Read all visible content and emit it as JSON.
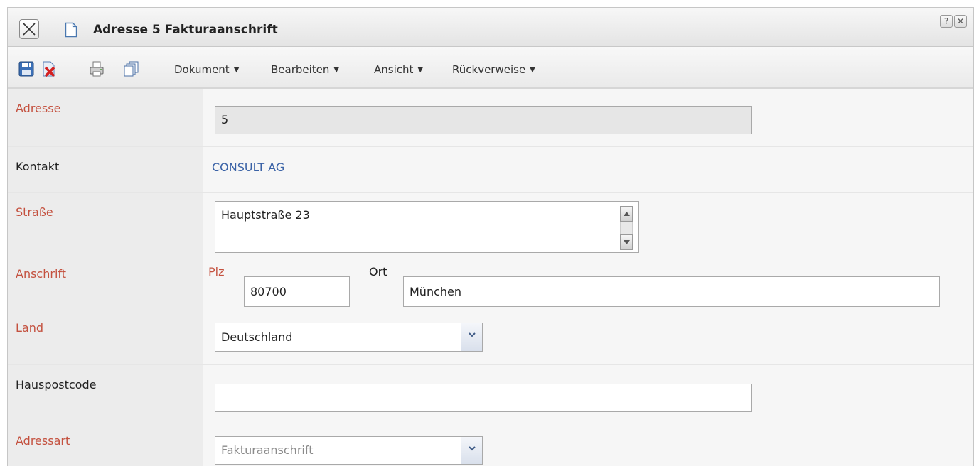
{
  "window": {
    "title": "Adresse 5 Fakturaanschrift",
    "help_label": "?",
    "close_label": "✕"
  },
  "toolbar": {
    "icons": [
      "save-icon",
      "delete-icon",
      "print-icon",
      "copy-icon"
    ],
    "menus": [
      {
        "label": "Dokument"
      },
      {
        "label": "Bearbeiten"
      },
      {
        "label": "Ansicht"
      },
      {
        "label": "Rückverweise"
      }
    ]
  },
  "form": {
    "adresse": {
      "label": "Adresse",
      "value": "5"
    },
    "kontakt": {
      "label": "Kontakt",
      "value": "CONSULT AG"
    },
    "strasse": {
      "label": "Straße",
      "value": "Hauptstraße 23"
    },
    "anschrift": {
      "label": "Anschrift",
      "plz_label": "Plz",
      "plz_value": "80700",
      "ort_label": "Ort",
      "ort_value": "München"
    },
    "land": {
      "label": "Land",
      "value": "Deutschland"
    },
    "hauspostcode": {
      "label": "Hauspostcode",
      "value": ""
    },
    "adressart": {
      "label": "Adressart",
      "value": "Fakturaanschrift"
    }
  },
  "colors": {
    "required_label": "#c4513f",
    "link": "#3a62a6",
    "label_bg": "#ececec",
    "field_bg": "#f6f6f6"
  }
}
